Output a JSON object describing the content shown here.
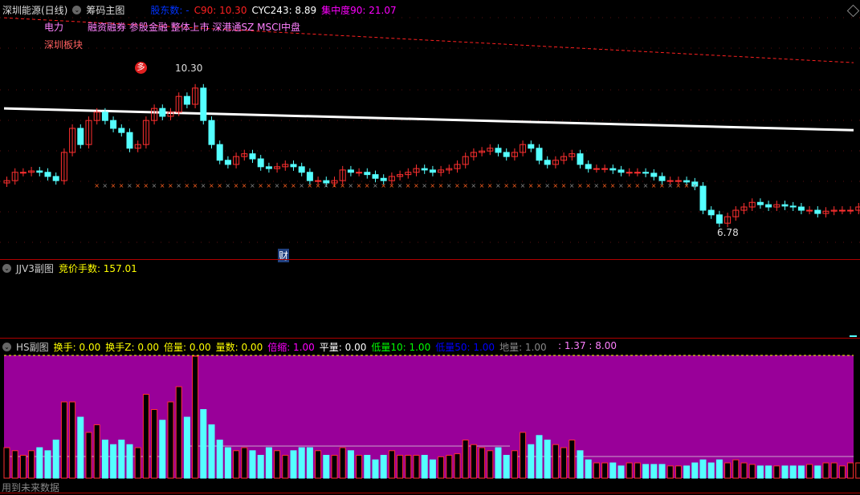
{
  "main": {
    "stock_name": "深圳能源(日线)",
    "indicator": "筹码主图",
    "holders_label": "股东数: -",
    "c90": "C90: 10.30",
    "cyc243": "CYC243: 8.89",
    "concentration": "集中度90: 21.07",
    "industry": "电力",
    "concepts": "融资融券 参股金融 整体上市 深港通SZ MSCI中盘",
    "region": "深圳板块",
    "signal_badge": "多",
    "high_label": "10.30",
    "low_label": "6.78",
    "finance_marker": "财"
  },
  "sub1": {
    "title": "JJV3副图",
    "value": "竞价手数: 157.01"
  },
  "sub2": {
    "title": "HS副图",
    "items": [
      {
        "text": "换手: 0.00",
        "color": "#ffff00"
      },
      {
        "text": "换手Z: 0.00",
        "color": "#ffff00"
      },
      {
        "text": "倍量: 0.00",
        "color": "#ffff00"
      },
      {
        "text": "量数: 0.00",
        "color": "#ffff00"
      },
      {
        "text": "倍缩: 1.00",
        "color": "#ff00ff"
      },
      {
        "text": "平量: 0.00",
        "color": "#ffffff"
      },
      {
        "text": "低量10: 1.00",
        "color": "#00ff00"
      },
      {
        "text": "低量50: 1.00",
        "color": "#0000ff"
      },
      {
        "text": "地量: 1.00",
        "color": "#888888"
      }
    ],
    "ratio": ": 1.37 : 8.00"
  },
  "footer": {
    "note": "用到未来数据"
  },
  "colors": {
    "up": "#ff3030",
    "down": "#54ffff",
    "volume_bg": "#990099",
    "border": "#b00000"
  },
  "chart_data": {
    "type": "candlestick",
    "price_range": [
      6.78,
      10.3
    ],
    "closes": [
      7.87,
      8.05,
      8.05,
      8.08,
      8.05,
      7.96,
      7.87,
      8.48,
      9.0,
      8.65,
      9.17,
      9.35,
      9.17,
      9.0,
      8.91,
      8.57,
      8.65,
      9.17,
      9.43,
      9.26,
      9.35,
      9.69,
      9.52,
      9.87,
      9.17,
      8.65,
      8.31,
      8.22,
      8.39,
      8.45,
      8.34,
      8.17,
      8.13,
      8.17,
      8.22,
      8.17,
      8.05,
      7.87,
      7.87,
      7.82,
      7.87,
      8.1,
      8.05,
      8.05,
      8.0,
      7.92,
      7.87,
      7.96,
      8.0,
      8.05,
      8.13,
      8.1,
      8.05,
      8.1,
      8.13,
      8.22,
      8.39,
      8.48,
      8.51,
      8.57,
      8.48,
      8.39,
      8.48,
      8.65,
      8.57,
      8.31,
      8.22,
      8.31,
      8.39,
      8.45,
      8.22,
      8.13,
      8.13,
      8.13,
      8.1,
      8.05,
      8.05,
      8.05,
      8.03,
      7.96,
      7.87,
      7.87,
      7.87,
      7.84,
      7.75,
      7.23,
      7.13,
      6.95,
      7.09,
      7.23,
      7.3,
      7.4,
      7.35,
      7.3,
      7.35,
      7.32,
      7.3,
      7.23,
      7.23,
      7.16,
      7.21,
      7.23,
      7.23,
      7.23,
      7.3,
      7.18
    ],
    "volumes": [
      20,
      18,
      15,
      18,
      20,
      18,
      25,
      50,
      50,
      40,
      30,
      35,
      25,
      22,
      25,
      22,
      20,
      55,
      45,
      38,
      50,
      60,
      40,
      80,
      45,
      35,
      25,
      20,
      18,
      20,
      18,
      15,
      20,
      18,
      15,
      18,
      20,
      20,
      18,
      15,
      15,
      20,
      18,
      15,
      15,
      12,
      15,
      18,
      15,
      15,
      15,
      15,
      12,
      14,
      15,
      16,
      25,
      22,
      20,
      18,
      20,
      15,
      18,
      30,
      22,
      28,
      25,
      22,
      20,
      25,
      18,
      12,
      10,
      10,
      10,
      8,
      10,
      10,
      9,
      9,
      9,
      8,
      8,
      8,
      10,
      12,
      10,
      12,
      10,
      12,
      10,
      9,
      8,
      8,
      8,
      8,
      8,
      8,
      9,
      8,
      10,
      10,
      8,
      10,
      10,
      8
    ],
    "ma_line": [
      9.43,
      8.96
    ],
    "c90_line": [
      11.39,
      10.42
    ]
  }
}
